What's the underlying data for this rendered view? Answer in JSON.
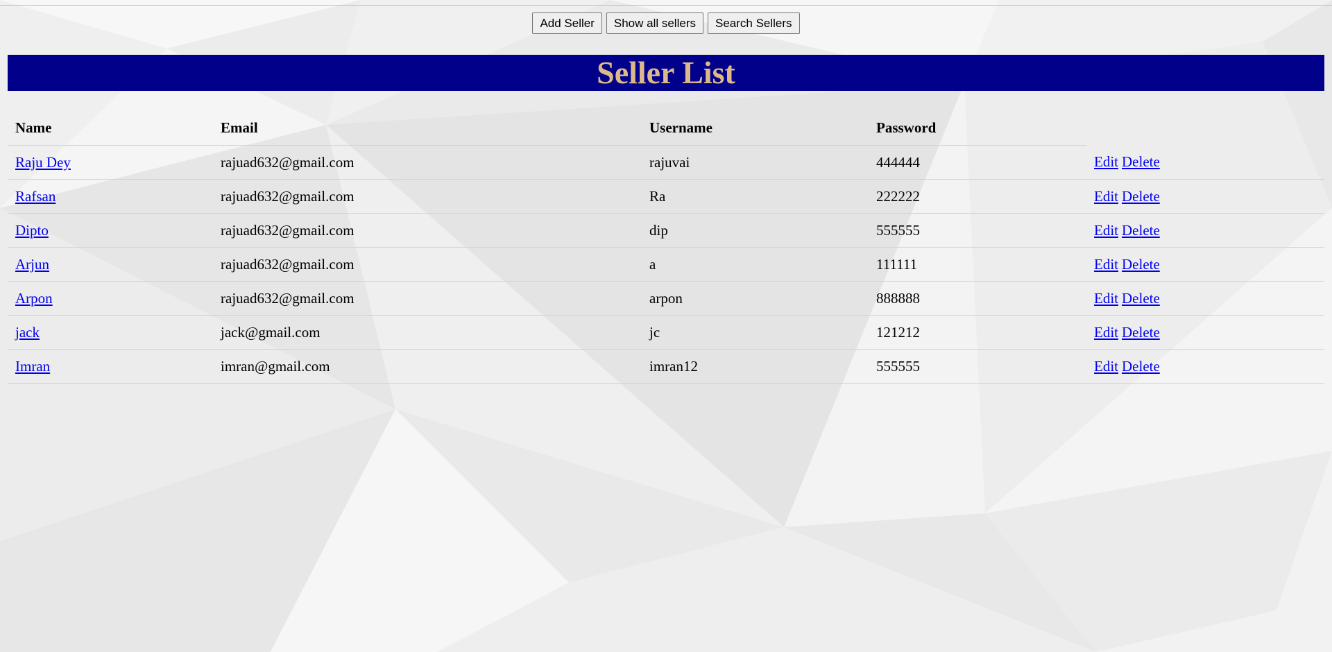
{
  "toolbar": {
    "add_label": "Add Seller",
    "show_label": "Show all sellers",
    "search_label": "Search Sellers"
  },
  "banner": {
    "title": "Seller List"
  },
  "table": {
    "headers": {
      "name": "Name",
      "email": "Email",
      "username": "Username",
      "password": "Password"
    },
    "rows": [
      {
        "name": "Raju Dey",
        "email": "rajuad632@gmail.com",
        "username": "rajuvai",
        "password": "444444",
        "edit": "Edit",
        "delete": "Delete"
      },
      {
        "name": "Rafsan",
        "email": "rajuad632@gmail.com",
        "username": "Ra",
        "password": "222222",
        "edit": "Edit",
        "delete": "Delete"
      },
      {
        "name": "Dipto",
        "email": "rajuad632@gmail.com",
        "username": "dip",
        "password": "555555",
        "edit": "Edit",
        "delete": "Delete"
      },
      {
        "name": "Arjun",
        "email": "rajuad632@gmail.com",
        "username": "a",
        "password": "111111",
        "edit": "Edit",
        "delete": "Delete"
      },
      {
        "name": "Arpon",
        "email": "rajuad632@gmail.com",
        "username": "arpon",
        "password": "888888",
        "edit": "Edit",
        "delete": "Delete"
      },
      {
        "name": "jack",
        "email": "jack@gmail.com",
        "username": "jc",
        "password": "121212",
        "edit": "Edit",
        "delete": "Delete"
      },
      {
        "name": "Imran",
        "email": "imran@gmail.com",
        "username": "imran12",
        "password": "555555",
        "edit": "Edit",
        "delete": "Delete"
      }
    ]
  },
  "colors": {
    "banner_bg": "#00008b",
    "banner_text": "#deb887",
    "link": "#0000ee"
  }
}
